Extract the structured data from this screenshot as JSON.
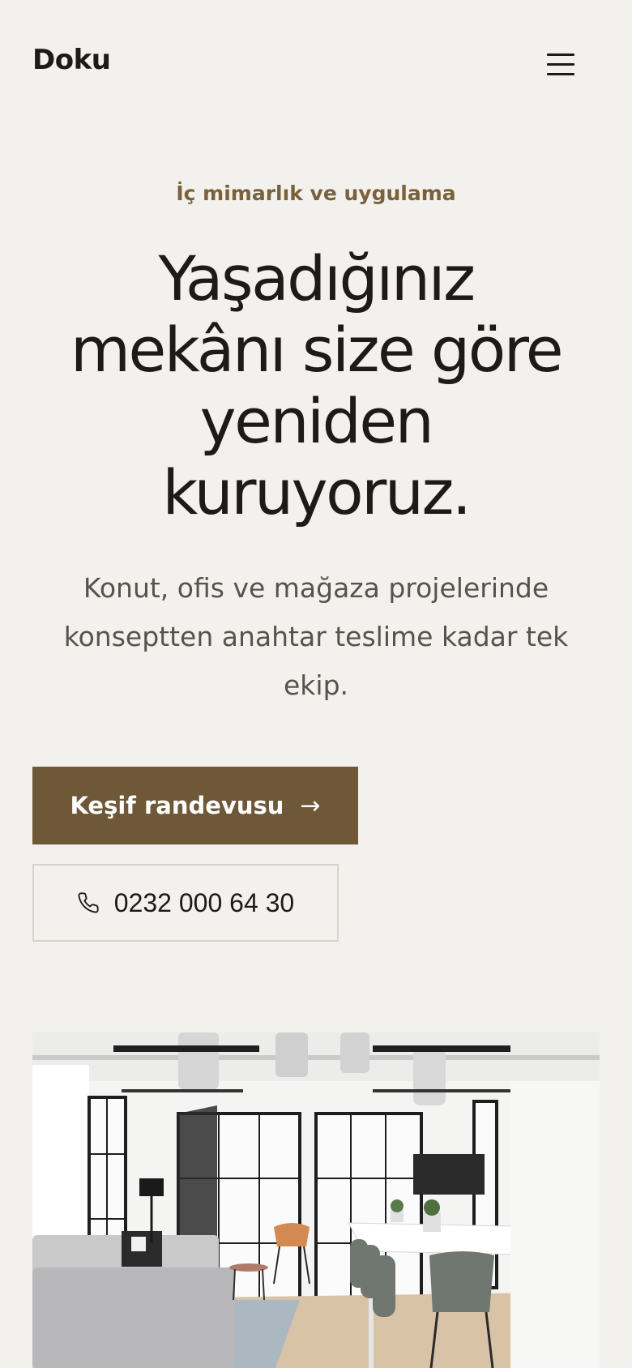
{
  "header": {
    "logo": "Doku",
    "menu_icon": "hamburger-menu-icon"
  },
  "hero": {
    "eyebrow": "İç mimarlık ve uygulama",
    "headline": "Yaşadığınız mekânı size göre yeniden kuruyoruz.",
    "lede": "Konut, ofis ve mağaza projelerinde konseptten anahtar teslime kadar tek ekip.",
    "primary_cta": {
      "label": "Keşif randevusu",
      "icon": "arrow-right-icon"
    },
    "secondary_cta": {
      "label": "0232 000 64 30",
      "icon": "phone-icon"
    },
    "photo": {
      "subject": "bright-office-interior-photo"
    }
  },
  "colors": {
    "background": "#f3f1ee",
    "accent": "#6e5837",
    "eyebrow": "#7a6139",
    "text": "#1c1b18",
    "muted_text": "#57534c"
  }
}
